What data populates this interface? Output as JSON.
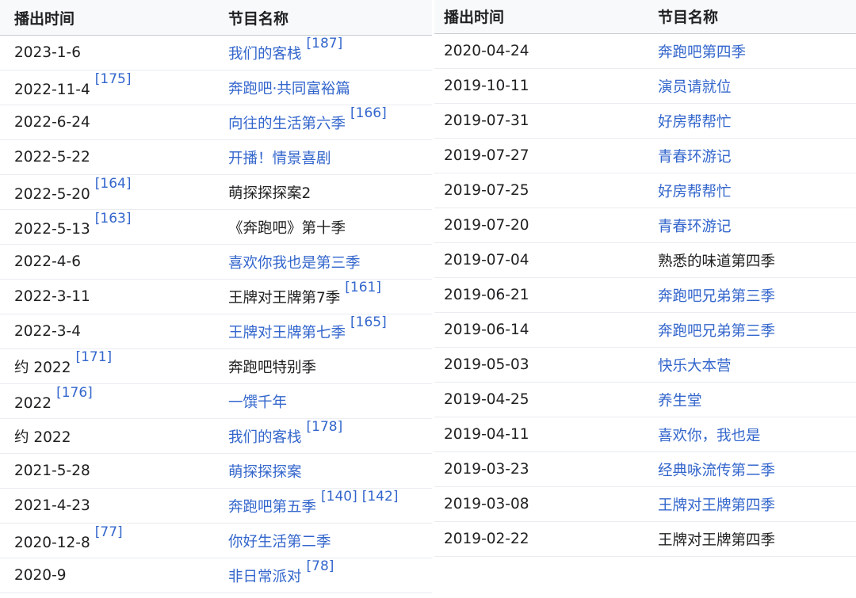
{
  "colors": {
    "link": "#3366cc",
    "text": "#202122",
    "header_bg": "#f8f9fa"
  },
  "left": {
    "headers": [
      "播出时间",
      "节目名称"
    ],
    "rows": [
      {
        "date": "2023-1-6",
        "date_refs": [],
        "title": "我们的客栈",
        "title_link": true,
        "title_refs": [
          "[187]"
        ]
      },
      {
        "date": "2022-11-4",
        "date_refs": [
          "[175]"
        ],
        "title": "奔跑吧·共同富裕篇",
        "title_link": true,
        "title_refs": []
      },
      {
        "date": "2022-6-24",
        "date_refs": [],
        "title": "向往的生活第六季",
        "title_link": true,
        "title_refs": [
          "[166]"
        ]
      },
      {
        "date": "2022-5-22",
        "date_refs": [],
        "title": "开播！情景喜剧",
        "title_link": true,
        "title_refs": []
      },
      {
        "date": "2022-5-20",
        "date_refs": [
          "[164]"
        ],
        "title": "萌探探探案2",
        "title_link": false,
        "title_refs": []
      },
      {
        "date": "2022-5-13",
        "date_refs": [
          "[163]"
        ],
        "title": "《奔跑吧》第十季",
        "title_link": false,
        "title_refs": []
      },
      {
        "date": "2022-4-6",
        "date_refs": [],
        "title": "喜欢你我也是第三季",
        "title_link": true,
        "title_refs": []
      },
      {
        "date": "2022-3-11",
        "date_refs": [],
        "title": "王牌对王牌第7季",
        "title_link": false,
        "title_refs": [
          "[161]"
        ]
      },
      {
        "date": "2022-3-4",
        "date_refs": [],
        "title": "王牌对王牌第七季",
        "title_link": true,
        "title_refs": [
          "[165]"
        ]
      },
      {
        "date": "约 2022",
        "date_refs": [
          "[171]"
        ],
        "title": "奔跑吧特别季",
        "title_link": false,
        "title_refs": []
      },
      {
        "date": "2022",
        "date_refs": [
          "[176]"
        ],
        "title": "一馔千年",
        "title_link": true,
        "title_refs": []
      },
      {
        "date": "约 2022",
        "date_refs": [],
        "title": "我们的客栈",
        "title_link": true,
        "title_refs": [
          "[178]"
        ]
      },
      {
        "date": "2021-5-28",
        "date_refs": [],
        "title": "萌探探探案",
        "title_link": true,
        "title_refs": []
      },
      {
        "date": "2021-4-23",
        "date_refs": [],
        "title": "奔跑吧第五季",
        "title_link": true,
        "title_refs": [
          "[140]",
          "[142]"
        ]
      },
      {
        "date": "2020-12-8",
        "date_refs": [
          "[77]"
        ],
        "title": "你好生活第二季",
        "title_link": true,
        "title_refs": []
      },
      {
        "date": "2020-9",
        "date_refs": [],
        "title": "非日常派对",
        "title_link": true,
        "title_refs": [
          "[78]"
        ]
      }
    ]
  },
  "right": {
    "headers": [
      "播出时间",
      "节目名称"
    ],
    "rows": [
      {
        "date": "2020-04-24",
        "date_refs": [],
        "title": "奔跑吧第四季",
        "title_link": true,
        "title_refs": []
      },
      {
        "date": "2019-10-11",
        "date_refs": [],
        "title": "演员请就位",
        "title_link": true,
        "title_refs": []
      },
      {
        "date": "2019-07-31",
        "date_refs": [],
        "title": "好房帮帮忙",
        "title_link": true,
        "title_refs": []
      },
      {
        "date": "2019-07-27",
        "date_refs": [],
        "title": "青春环游记",
        "title_link": true,
        "title_refs": []
      },
      {
        "date": "2019-07-25",
        "date_refs": [],
        "title": "好房帮帮忙",
        "title_link": true,
        "title_refs": []
      },
      {
        "date": "2019-07-20",
        "date_refs": [],
        "title": "青春环游记",
        "title_link": true,
        "title_refs": []
      },
      {
        "date": "2019-07-04",
        "date_refs": [],
        "title": "熟悉的味道第四季",
        "title_link": false,
        "title_refs": []
      },
      {
        "date": "2019-06-21",
        "date_refs": [],
        "title": "奔跑吧兄弟第三季",
        "title_link": true,
        "title_refs": []
      },
      {
        "date": "2019-06-14",
        "date_refs": [],
        "title": "奔跑吧兄弟第三季",
        "title_link": true,
        "title_refs": []
      },
      {
        "date": "2019-05-03",
        "date_refs": [],
        "title": "快乐大本营",
        "title_link": true,
        "title_refs": []
      },
      {
        "date": "2019-04-25",
        "date_refs": [],
        "title": "养生堂",
        "title_link": true,
        "title_refs": []
      },
      {
        "date": "2019-04-11",
        "date_refs": [],
        "title": "喜欢你，我也是",
        "title_link": true,
        "title_refs": []
      },
      {
        "date": "2019-03-23",
        "date_refs": [],
        "title": "经典咏流传第二季",
        "title_link": true,
        "title_refs": []
      },
      {
        "date": "2019-03-08",
        "date_refs": [],
        "title": "王牌对王牌第四季",
        "title_link": true,
        "title_refs": []
      },
      {
        "date": "2019-02-22",
        "date_refs": [],
        "title": "王牌对王牌第四季",
        "title_link": false,
        "title_refs": []
      }
    ]
  }
}
